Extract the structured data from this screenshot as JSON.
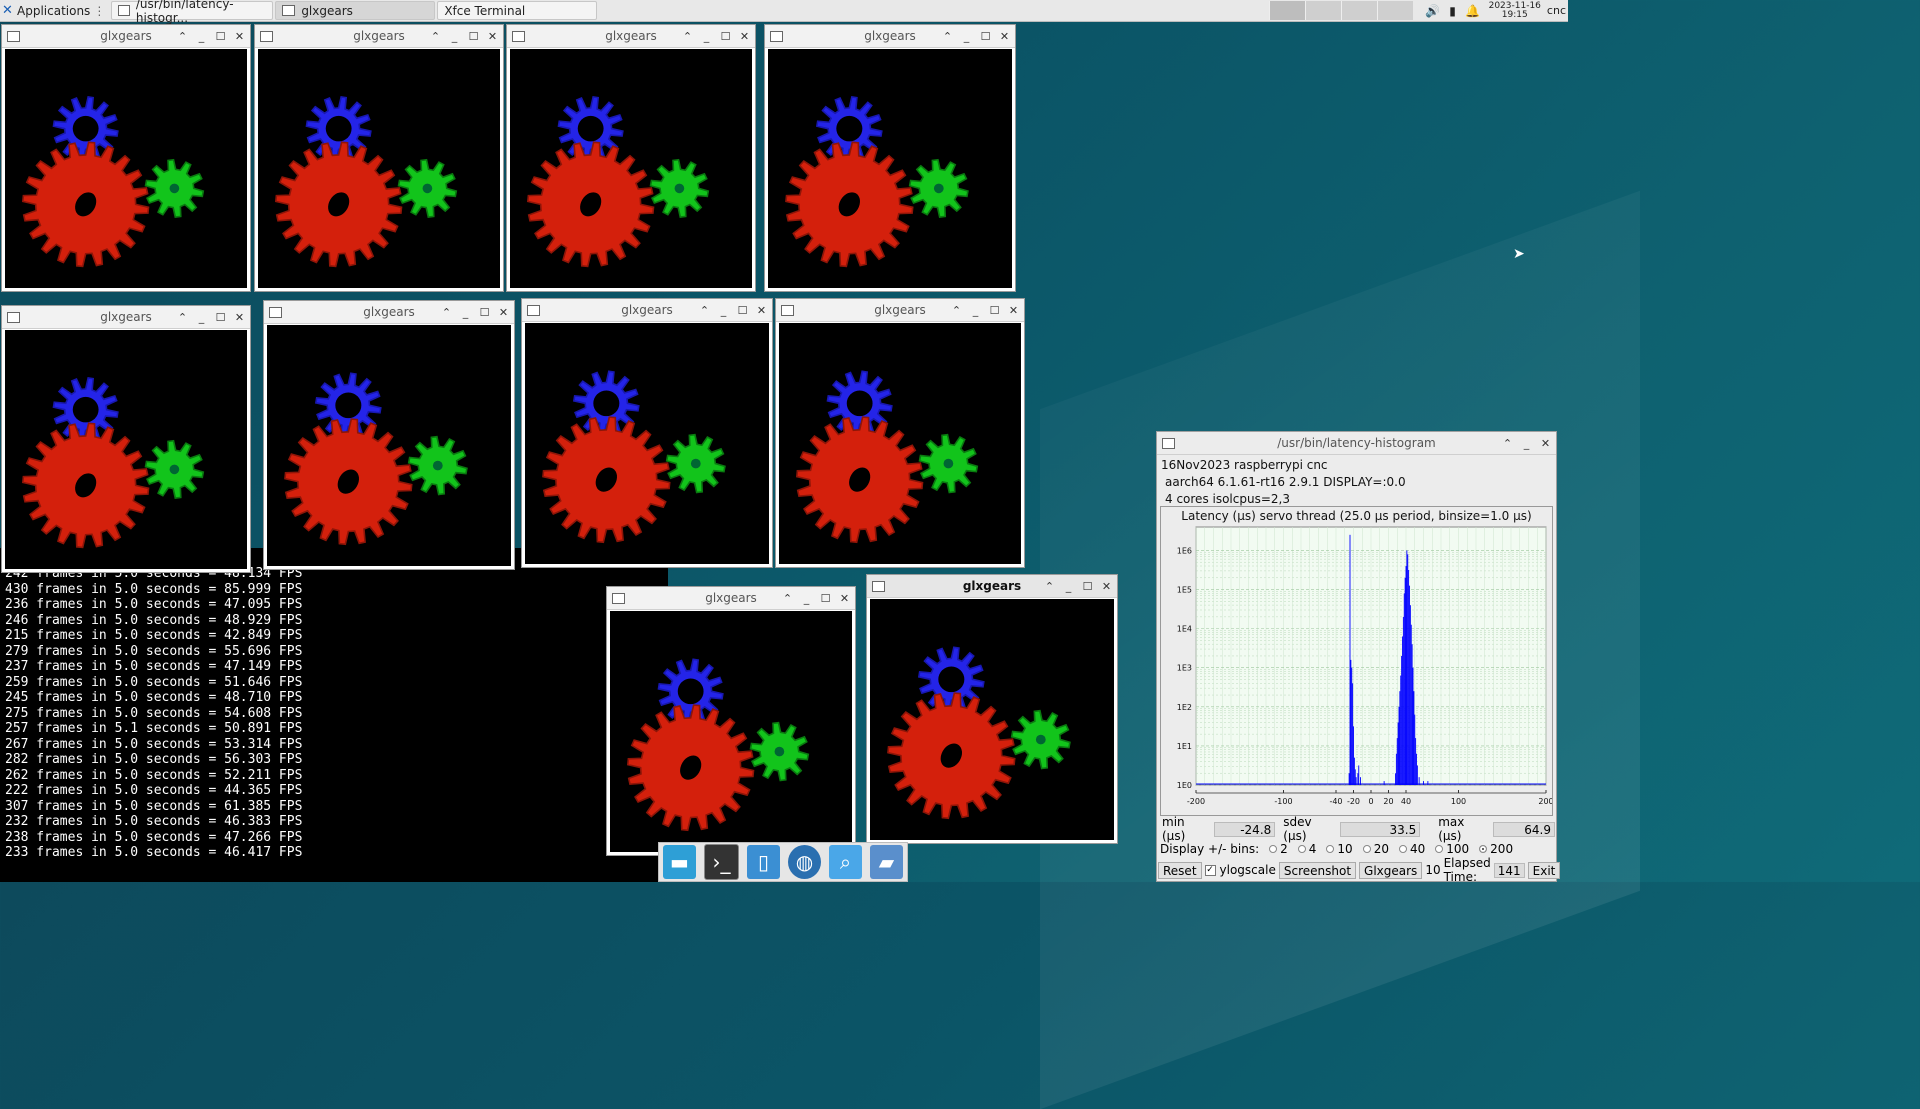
{
  "panel": {
    "applications_label": "Applications",
    "tasks": [
      {
        "label": "/usr/bin/latency-histogr..."
      },
      {
        "label": "glxgears"
      },
      {
        "label": "Xfce Terminal"
      }
    ],
    "clock_date": "2023-11-16",
    "clock_time": "19:15",
    "user": "cnc"
  },
  "glx_title": "glxgears",
  "colors": {
    "gear_red": "#d4200c",
    "gear_green": "#12c41b",
    "gear_blue": "#2424e8",
    "histogram_bar": "#0000ff"
  },
  "terminal": {
    "lines": [
      "242 frames in 5.0 seconds = 48.134 FPS",
      "430 frames in 5.0 seconds = 85.999 FPS",
      "236 frames in 5.0 seconds = 47.095 FPS",
      "246 frames in 5.0 seconds = 48.929 FPS",
      "215 frames in 5.0 seconds = 42.849 FPS",
      "279 frames in 5.0 seconds = 55.696 FPS",
      "237 frames in 5.0 seconds = 47.149 FPS",
      "259 frames in 5.0 seconds = 51.646 FPS",
      "245 frames in 5.0 seconds = 48.710 FPS",
      "275 frames in 5.0 seconds = 54.608 FPS",
      "257 frames in 5.1 seconds = 50.891 FPS",
      "267 frames in 5.0 seconds = 53.314 FPS",
      "282 frames in 5.0 seconds = 56.303 FPS",
      "262 frames in 5.0 seconds = 52.211 FPS",
      "222 frames in 5.0 seconds = 44.365 FPS",
      "307 frames in 5.0 seconds = 61.385 FPS",
      "232 frames in 5.0 seconds = 46.383 FPS",
      "238 frames in 5.0 seconds = 47.266 FPS",
      "233 frames in 5.0 seconds = 46.417 FPS"
    ]
  },
  "latency": {
    "window_title": "/usr/bin/latency-histogram",
    "info1": "16Nov2023 raspberrypi cnc",
    "info2": "aarch64  6.1.61-rt16  2.9.1  DISPLAY=:0.0",
    "info3": "4 cores  isolcpus=2,3",
    "min_label": "min (µs)",
    "min_val": "-24.8",
    "sdev_label": "sdev (µs)",
    "sdev_val": "33.5",
    "max_label": "max (µs)",
    "max_val": "64.9",
    "bins_label": "Display +/- bins:",
    "bin_options": [
      "2",
      "4",
      "10",
      "20",
      "40",
      "100",
      "200"
    ],
    "bin_selected": "200",
    "reset_label": "Reset",
    "ylogscale_label": "ylogscale",
    "screenshot_label": "Screenshot",
    "glxgears_label": "Glxgears",
    "glxgears_count": "10",
    "elapsed_label": "Elapsed Time:",
    "elapsed_val": "141",
    "exit_label": "Exit"
  },
  "chart_data": {
    "type": "bar",
    "title": "Latency (µs) servo thread (25.0 µs period, binsize=1.0 µs)",
    "xlim": [
      -200,
      200
    ],
    "x_ticks": [
      "-200",
      "-100",
      "-40",
      "-20",
      "0",
      "20",
      "40",
      "100",
      "200"
    ],
    "x_tick_values": [
      -200,
      -100,
      -40,
      -20,
      0,
      20,
      40,
      100,
      200
    ],
    "y_scale": "log",
    "ylim_exp": [
      0,
      6.6
    ],
    "y_ticks": [
      "1E0",
      "1E1",
      "1E2",
      "1E3",
      "1E4",
      "1E5",
      "1E6"
    ],
    "y_tick_values": [
      0,
      1,
      2,
      3,
      4,
      5,
      6
    ],
    "grid": true,
    "bins_x": [
      -25,
      -24,
      -23,
      -22,
      -21,
      -20,
      -19,
      -18,
      -17,
      -15,
      -14,
      -12,
      15,
      28,
      29,
      30,
      31,
      32,
      33,
      34,
      35,
      36,
      37,
      38,
      39,
      40,
      41,
      42,
      43,
      44,
      45,
      46,
      47,
      48,
      49,
      50,
      51,
      52,
      53,
      55,
      60,
      65
    ],
    "bins_log": [
      0.3,
      6.4,
      3.2,
      3.0,
      2.6,
      1.5,
      0.7,
      0.4,
      0.2,
      0.3,
      0.5,
      0.2,
      0.1,
      0.3,
      0.8,
      1.2,
      1.6,
      2.0,
      2.4,
      2.8,
      3.3,
      3.8,
      4.3,
      4.9,
      5.3,
      5.6,
      6.0,
      5.9,
      5.5,
      5.1,
      4.6,
      4.1,
      3.6,
      3.0,
      2.4,
      1.8,
      1.2,
      0.8,
      0.5,
      0.2,
      0.1,
      0.1
    ]
  }
}
